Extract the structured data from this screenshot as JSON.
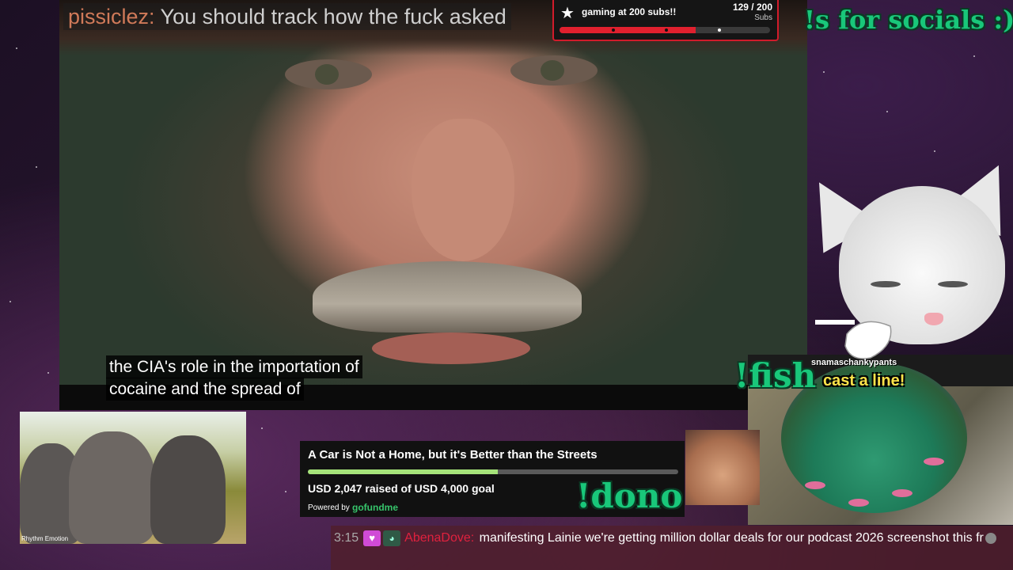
{
  "top_chat": {
    "username": "pissiclez:",
    "message": "You should track how the fuck asked"
  },
  "sub_goal": {
    "title": "gaming at 200 subs!!",
    "current": 129,
    "goal": 200,
    "count_text": "129 / 200",
    "unit": "Subs",
    "progress": 0.645
  },
  "socials_cmd": "!s for socials :)",
  "video": {
    "caption_line1": "the CIA's role in the importation of",
    "caption_line2": "cocaine and the spread of"
  },
  "fish_game": {
    "command": "!fish",
    "username": "snamaschankypants",
    "prompt": "cast a line!"
  },
  "elephant_video": {
    "watermark": "Rhythm Emotion"
  },
  "gofundme": {
    "title": "A Car is Not a Home, but it's Better than the Streets",
    "raised_text": "USD 2,047 raised of USD 4,000 goal",
    "raised": 2047,
    "goal": 4000,
    "progress": 0.512,
    "powered_by": "Powered by",
    "brand": "gofundme"
  },
  "dono_cmd": "!dono",
  "chat": {
    "time": "3:15",
    "username": "AbenaDove:",
    "message": "manifesting Lainie we're getting million dollar deals for our podcast 2026 screenshot this fr"
  },
  "colors": {
    "accent_red": "#d11b2b",
    "command_green": "#19c77a",
    "gfm_green": "#a6e37a",
    "chat_user": "#e0213e"
  }
}
